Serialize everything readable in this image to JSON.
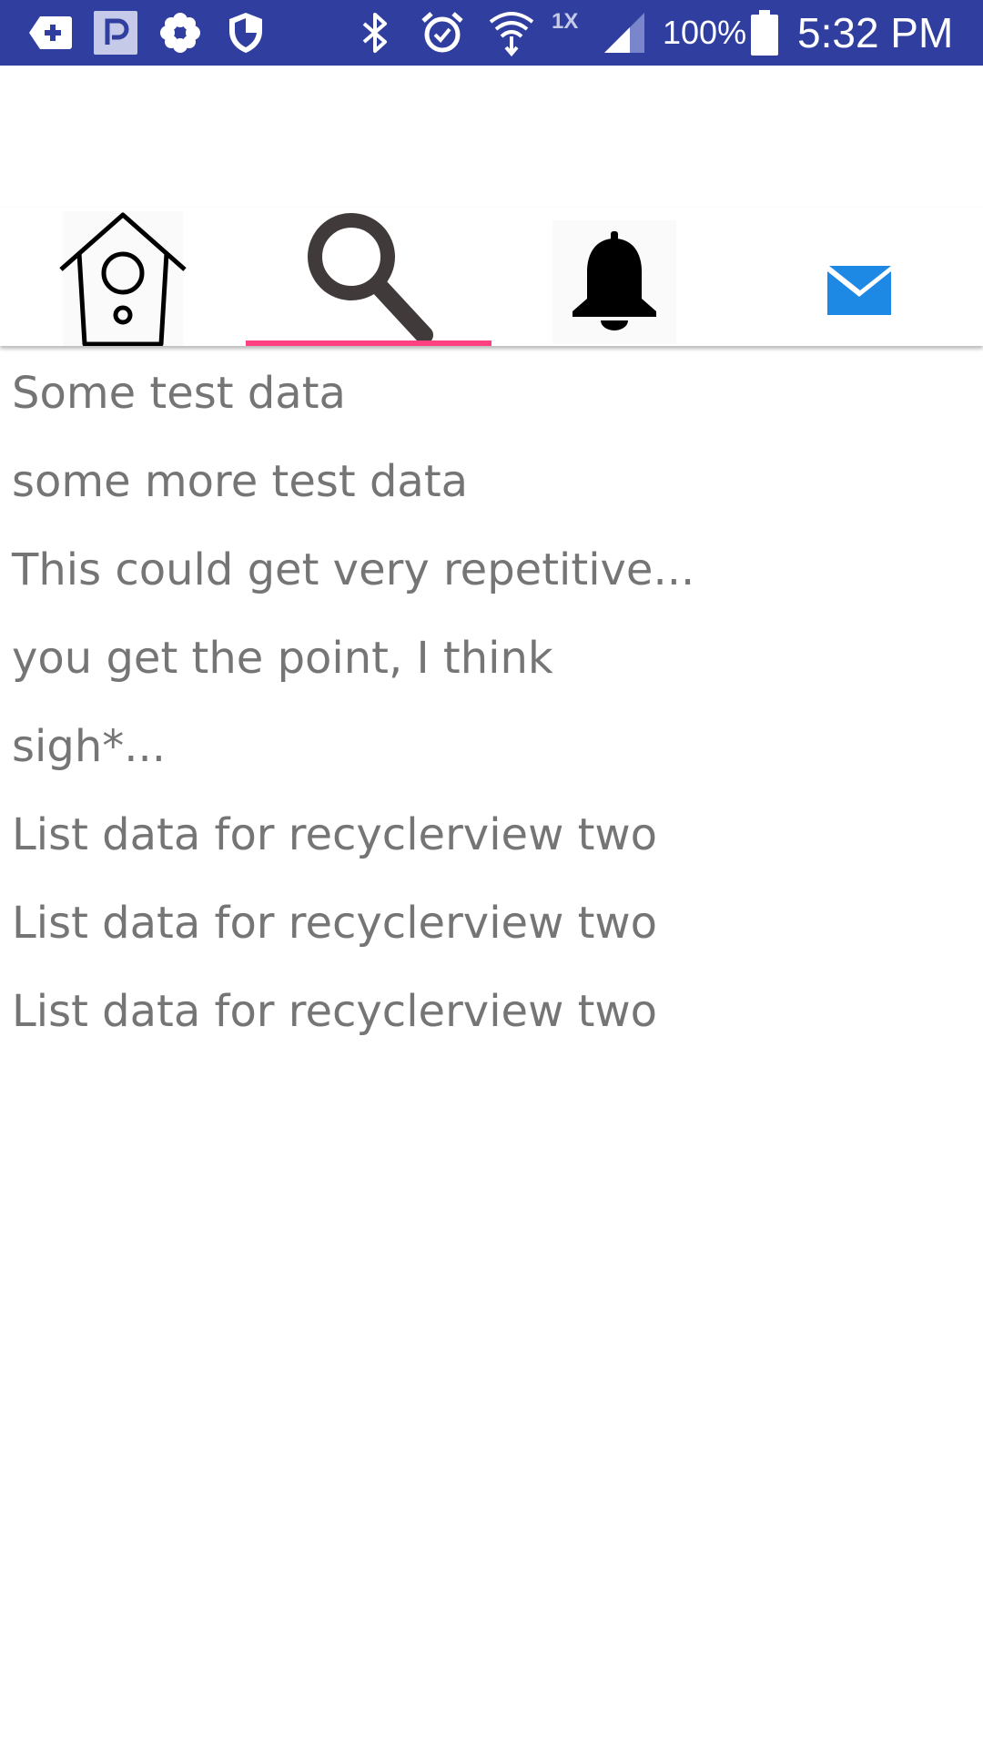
{
  "status_bar": {
    "background_color": "#303f9f",
    "icons": [
      "add-tab-icon",
      "parking-icon",
      "flower-icon",
      "shield-icon",
      "bluetooth-icon",
      "alarm-icon",
      "wifi-icon",
      "signal-icon",
      "battery-icon"
    ],
    "network_label": "1X",
    "battery_percent": "100%",
    "time": "5:32 PM"
  },
  "tabs": [
    {
      "icon": "birdhouse-icon",
      "selected": false
    },
    {
      "icon": "search-icon",
      "selected": true
    },
    {
      "icon": "bell-icon",
      "selected": false
    },
    {
      "icon": "mail-icon",
      "selected": false
    }
  ],
  "tab_indicator_color": "#ff4081",
  "list": {
    "text_color": "#757575",
    "items": [
      "Some test data",
      "some more test data",
      "This could get very repetitive...",
      "you get the point, I think",
      "sigh*...",
      "List data for recyclerview two",
      "List data for recyclerview two",
      "List data for recyclerview two"
    ]
  }
}
